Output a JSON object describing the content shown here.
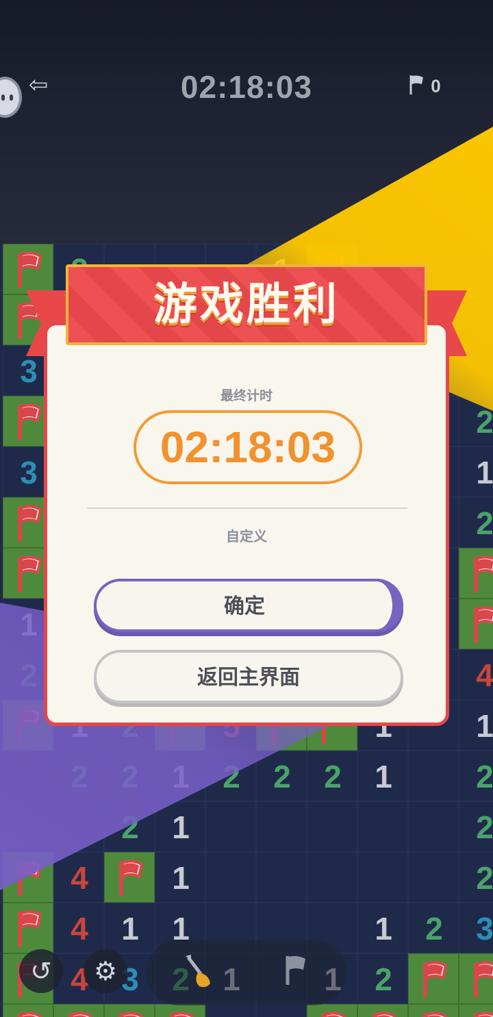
{
  "header": {
    "timer": "02:18:03",
    "flag_count": "0",
    "exit_icon": "exit-icon",
    "avatar_icon": "avatar-icon"
  },
  "board": {
    "colors": {
      "unrevealed": "#4f8a3c",
      "revealed": "#1f2a4a",
      "n1": "#c7cad2",
      "n2": "#4aa36a",
      "n3": "#2b8fb4",
      "n4": "#c9453d",
      "n5": "#c9453d",
      "flag_red": "#d9474b"
    },
    "cells": [
      {
        "r": 0,
        "c": 0,
        "t": "F"
      },
      {
        "r": 0,
        "c": 1,
        "t": "2"
      },
      {
        "r": 0,
        "c": 5,
        "t": "1"
      },
      {
        "r": 0,
        "c": 6,
        "t": "F"
      },
      {
        "r": 1,
        "c": 0,
        "t": "F"
      },
      {
        "r": 2,
        "c": 0,
        "t": "3"
      },
      {
        "r": 3,
        "c": 0,
        "t": "F"
      },
      {
        "r": 3,
        "c": 9,
        "t": "2"
      },
      {
        "r": 4,
        "c": 0,
        "t": "3"
      },
      {
        "r": 4,
        "c": 9,
        "t": "1"
      },
      {
        "r": 5,
        "c": 0,
        "t": "F"
      },
      {
        "r": 5,
        "c": 9,
        "t": "2"
      },
      {
        "r": 6,
        "c": 0,
        "t": "F"
      },
      {
        "r": 6,
        "c": 9,
        "t": "F"
      },
      {
        "r": 7,
        "c": 0,
        "t": "1"
      },
      {
        "r": 7,
        "c": 9,
        "t": "F"
      },
      {
        "r": 8,
        "c": 0,
        "t": "2"
      },
      {
        "r": 8,
        "c": 9,
        "t": "4"
      },
      {
        "r": 9,
        "c": 0,
        "t": "F"
      },
      {
        "r": 9,
        "c": 1,
        "t": "1"
      },
      {
        "r": 9,
        "c": 2,
        "t": "2"
      },
      {
        "r": 9,
        "c": 3,
        "t": "F"
      },
      {
        "r": 9,
        "c": 4,
        "t": "5"
      },
      {
        "r": 9,
        "c": 5,
        "t": "F"
      },
      {
        "r": 9,
        "c": 6,
        "t": "F"
      },
      {
        "r": 9,
        "c": 7,
        "t": "1"
      },
      {
        "r": 9,
        "c": 9,
        "t": "1"
      },
      {
        "r": 10,
        "c": 1,
        "t": "2"
      },
      {
        "r": 10,
        "c": 2,
        "t": "2"
      },
      {
        "r": 10,
        "c": 3,
        "t": "1"
      },
      {
        "r": 10,
        "c": 4,
        "t": "2"
      },
      {
        "r": 10,
        "c": 5,
        "t": "2"
      },
      {
        "r": 10,
        "c": 6,
        "t": "2"
      },
      {
        "r": 10,
        "c": 7,
        "t": "1"
      },
      {
        "r": 10,
        "c": 9,
        "t": "2"
      },
      {
        "r": 11,
        "c": 2,
        "t": "2"
      },
      {
        "r": 11,
        "c": 3,
        "t": "1"
      },
      {
        "r": 11,
        "c": 9,
        "t": "2"
      },
      {
        "r": 12,
        "c": 0,
        "t": "F"
      },
      {
        "r": 12,
        "c": 1,
        "t": "4"
      },
      {
        "r": 12,
        "c": 2,
        "t": "F"
      },
      {
        "r": 12,
        "c": 3,
        "t": "1"
      },
      {
        "r": 12,
        "c": 9,
        "t": "2"
      },
      {
        "r": 13,
        "c": 0,
        "t": "F"
      },
      {
        "r": 13,
        "c": 1,
        "t": "4"
      },
      {
        "r": 13,
        "c": 2,
        "t": "1"
      },
      {
        "r": 13,
        "c": 3,
        "t": "1"
      },
      {
        "r": 13,
        "c": 7,
        "t": "1"
      },
      {
        "r": 13,
        "c": 8,
        "t": "2"
      },
      {
        "r": 13,
        "c": 9,
        "t": "3"
      },
      {
        "r": 14,
        "c": 0,
        "t": "F"
      },
      {
        "r": 14,
        "c": 1,
        "t": "4"
      },
      {
        "r": 14,
        "c": 2,
        "t": "3"
      },
      {
        "r": 14,
        "c": 3,
        "t": "2"
      },
      {
        "r": 14,
        "c": 4,
        "t": "1"
      },
      {
        "r": 14,
        "c": 6,
        "t": "1"
      },
      {
        "r": 14,
        "c": 7,
        "t": "2"
      },
      {
        "r": 14,
        "c": 8,
        "t": "F"
      },
      {
        "r": 14,
        "c": 9,
        "t": "F"
      },
      {
        "r": 15,
        "c": 0,
        "t": "F"
      },
      {
        "r": 15,
        "c": 1,
        "t": "F"
      },
      {
        "r": 15,
        "c": 2,
        "t": "F"
      },
      {
        "r": 15,
        "c": 3,
        "t": "F"
      },
      {
        "r": 15,
        "c": 6,
        "t": "F"
      },
      {
        "r": 15,
        "c": 7,
        "t": "F"
      },
      {
        "r": 15,
        "c": 8,
        "t": "F"
      },
      {
        "r": 15,
        "c": 9,
        "t": "F"
      }
    ]
  },
  "dialog": {
    "title": "游戏胜利",
    "final_time_label": "最终计时",
    "final_time": "02:18:03",
    "mode": "自定义",
    "confirm_label": "确定",
    "home_label": "返回主界面"
  },
  "bottom_bar": {
    "undo_icon": "undo-icon",
    "settings_icon": "gear-icon",
    "shovel_icon": "shovel-icon",
    "flag_tool_icon": "flag-icon"
  }
}
